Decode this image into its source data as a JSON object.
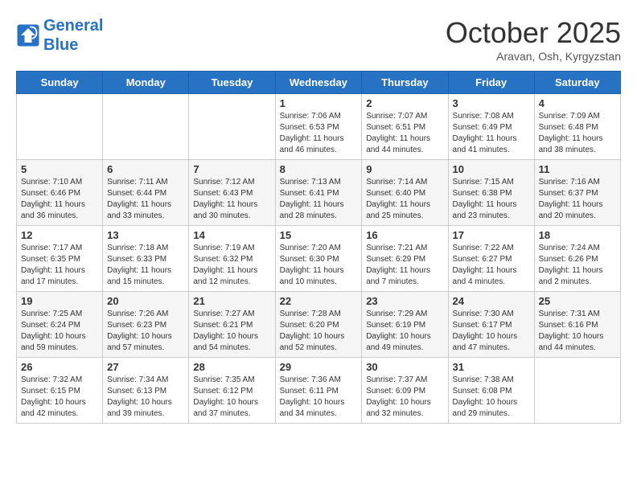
{
  "logo": {
    "line1": "General",
    "line2": "Blue"
  },
  "title": "October 2025",
  "subtitle": "Aravan, Osh, Kyrgyzstan",
  "days_of_week": [
    "Sunday",
    "Monday",
    "Tuesday",
    "Wednesday",
    "Thursday",
    "Friday",
    "Saturday"
  ],
  "weeks": [
    [
      {
        "day": "",
        "info": ""
      },
      {
        "day": "",
        "info": ""
      },
      {
        "day": "",
        "info": ""
      },
      {
        "day": "1",
        "info": "Sunrise: 7:06 AM\nSunset: 6:53 PM\nDaylight: 11 hours and 46 minutes."
      },
      {
        "day": "2",
        "info": "Sunrise: 7:07 AM\nSunset: 6:51 PM\nDaylight: 11 hours and 44 minutes."
      },
      {
        "day": "3",
        "info": "Sunrise: 7:08 AM\nSunset: 6:49 PM\nDaylight: 11 hours and 41 minutes."
      },
      {
        "day": "4",
        "info": "Sunrise: 7:09 AM\nSunset: 6:48 PM\nDaylight: 11 hours and 38 minutes."
      }
    ],
    [
      {
        "day": "5",
        "info": "Sunrise: 7:10 AM\nSunset: 6:46 PM\nDaylight: 11 hours and 36 minutes."
      },
      {
        "day": "6",
        "info": "Sunrise: 7:11 AM\nSunset: 6:44 PM\nDaylight: 11 hours and 33 minutes."
      },
      {
        "day": "7",
        "info": "Sunrise: 7:12 AM\nSunset: 6:43 PM\nDaylight: 11 hours and 30 minutes."
      },
      {
        "day": "8",
        "info": "Sunrise: 7:13 AM\nSunset: 6:41 PM\nDaylight: 11 hours and 28 minutes."
      },
      {
        "day": "9",
        "info": "Sunrise: 7:14 AM\nSunset: 6:40 PM\nDaylight: 11 hours and 25 minutes."
      },
      {
        "day": "10",
        "info": "Sunrise: 7:15 AM\nSunset: 6:38 PM\nDaylight: 11 hours and 23 minutes."
      },
      {
        "day": "11",
        "info": "Sunrise: 7:16 AM\nSunset: 6:37 PM\nDaylight: 11 hours and 20 minutes."
      }
    ],
    [
      {
        "day": "12",
        "info": "Sunrise: 7:17 AM\nSunset: 6:35 PM\nDaylight: 11 hours and 17 minutes."
      },
      {
        "day": "13",
        "info": "Sunrise: 7:18 AM\nSunset: 6:33 PM\nDaylight: 11 hours and 15 minutes."
      },
      {
        "day": "14",
        "info": "Sunrise: 7:19 AM\nSunset: 6:32 PM\nDaylight: 11 hours and 12 minutes."
      },
      {
        "day": "15",
        "info": "Sunrise: 7:20 AM\nSunset: 6:30 PM\nDaylight: 11 hours and 10 minutes."
      },
      {
        "day": "16",
        "info": "Sunrise: 7:21 AM\nSunset: 6:29 PM\nDaylight: 11 hours and 7 minutes."
      },
      {
        "day": "17",
        "info": "Sunrise: 7:22 AM\nSunset: 6:27 PM\nDaylight: 11 hours and 4 minutes."
      },
      {
        "day": "18",
        "info": "Sunrise: 7:24 AM\nSunset: 6:26 PM\nDaylight: 11 hours and 2 minutes."
      }
    ],
    [
      {
        "day": "19",
        "info": "Sunrise: 7:25 AM\nSunset: 6:24 PM\nDaylight: 10 hours and 59 minutes."
      },
      {
        "day": "20",
        "info": "Sunrise: 7:26 AM\nSunset: 6:23 PM\nDaylight: 10 hours and 57 minutes."
      },
      {
        "day": "21",
        "info": "Sunrise: 7:27 AM\nSunset: 6:21 PM\nDaylight: 10 hours and 54 minutes."
      },
      {
        "day": "22",
        "info": "Sunrise: 7:28 AM\nSunset: 6:20 PM\nDaylight: 10 hours and 52 minutes."
      },
      {
        "day": "23",
        "info": "Sunrise: 7:29 AM\nSunset: 6:19 PM\nDaylight: 10 hours and 49 minutes."
      },
      {
        "day": "24",
        "info": "Sunrise: 7:30 AM\nSunset: 6:17 PM\nDaylight: 10 hours and 47 minutes."
      },
      {
        "day": "25",
        "info": "Sunrise: 7:31 AM\nSunset: 6:16 PM\nDaylight: 10 hours and 44 minutes."
      }
    ],
    [
      {
        "day": "26",
        "info": "Sunrise: 7:32 AM\nSunset: 6:15 PM\nDaylight: 10 hours and 42 minutes."
      },
      {
        "day": "27",
        "info": "Sunrise: 7:34 AM\nSunset: 6:13 PM\nDaylight: 10 hours and 39 minutes."
      },
      {
        "day": "28",
        "info": "Sunrise: 7:35 AM\nSunset: 6:12 PM\nDaylight: 10 hours and 37 minutes."
      },
      {
        "day": "29",
        "info": "Sunrise: 7:36 AM\nSunset: 6:11 PM\nDaylight: 10 hours and 34 minutes."
      },
      {
        "day": "30",
        "info": "Sunrise: 7:37 AM\nSunset: 6:09 PM\nDaylight: 10 hours and 32 minutes."
      },
      {
        "day": "31",
        "info": "Sunrise: 7:38 AM\nSunset: 6:08 PM\nDaylight: 10 hours and 29 minutes."
      },
      {
        "day": "",
        "info": ""
      }
    ]
  ]
}
